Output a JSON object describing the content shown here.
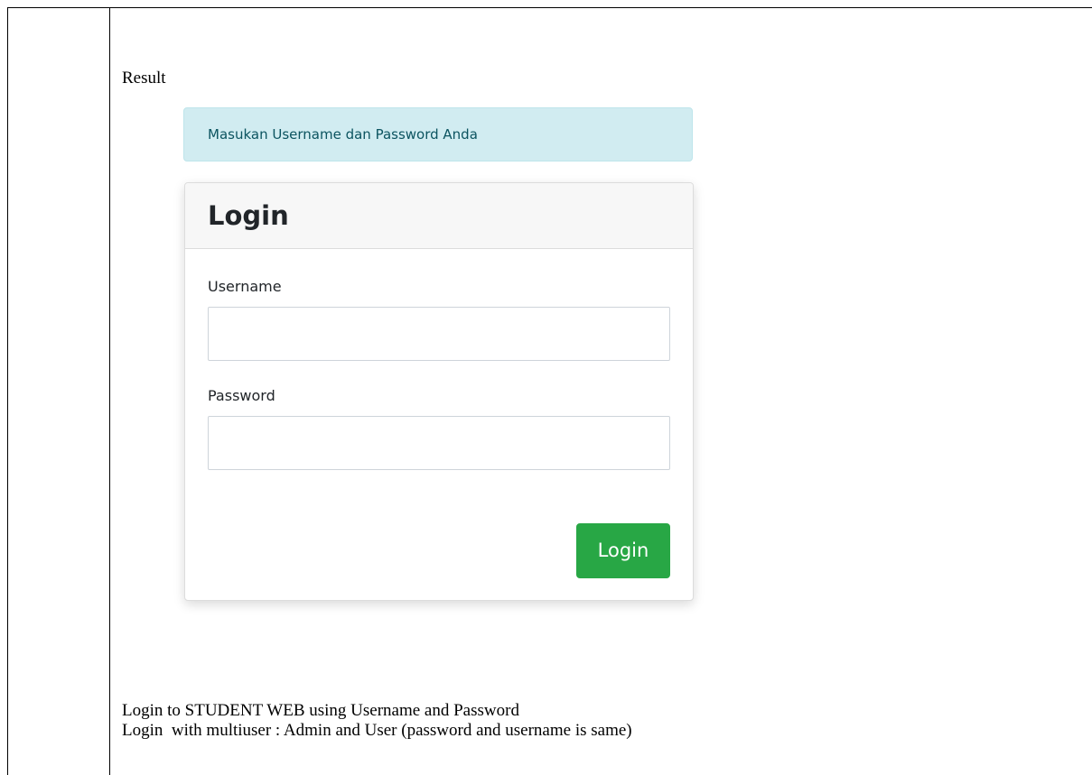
{
  "document": {
    "result_label": "Result",
    "description_lines": [
      "Login to STUDENT WEB using Username and Password",
      "Login  with multiuser : Admin and User (password and username is same)"
    ]
  },
  "login_page": {
    "alert_text": "Masukan Username dan Password Anda",
    "card_title": "Login",
    "username_label": "Username",
    "username_value": "",
    "password_label": "Password",
    "password_value": "",
    "submit_label": "Login"
  },
  "colors": {
    "alert_background": "#d1ecf1",
    "alert_text": "#0c5460",
    "button_background": "#28a745",
    "button_text": "#ffffff"
  }
}
